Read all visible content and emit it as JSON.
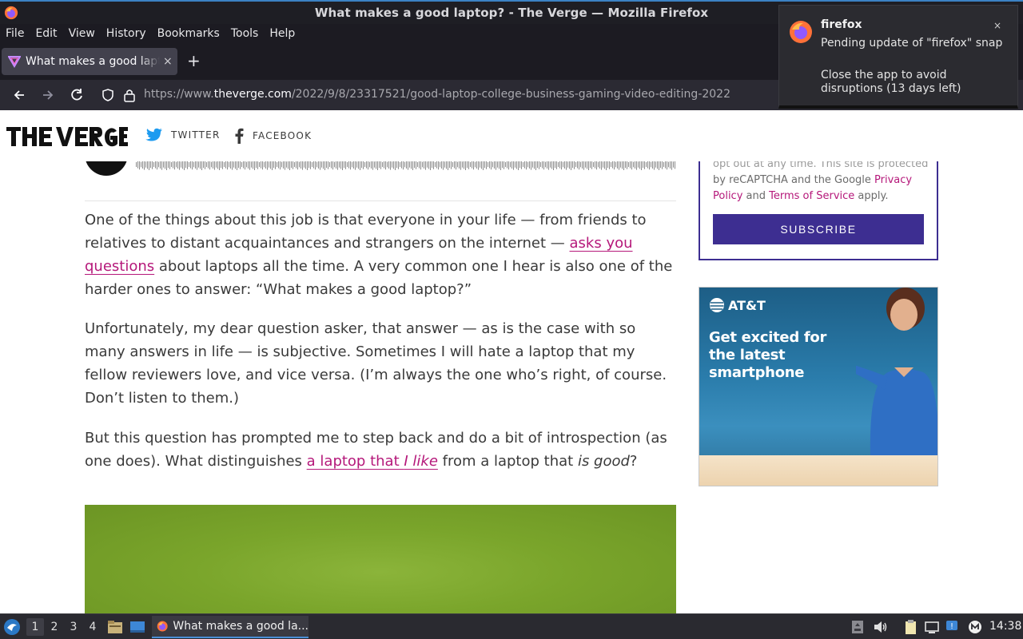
{
  "window": {
    "title": "What makes a good laptop? - The Verge — Mozilla Firefox"
  },
  "menu": {
    "items": [
      {
        "label": "File"
      },
      {
        "label": "Edit"
      },
      {
        "label": "View"
      },
      {
        "label": "History"
      },
      {
        "label": "Bookmarks"
      },
      {
        "label": "Tools"
      },
      {
        "label": "Help"
      }
    ]
  },
  "tab": {
    "title": "What makes a good laptop? - The Verge",
    "close": "×",
    "new_tab": "+"
  },
  "urlbar": {
    "prefix": "https://www.",
    "domain": "theverge.com",
    "path": "/2022/9/8/23317521/good-laptop-college-business-gaming-video-editing-2022"
  },
  "site": {
    "twitter_label": "TWITTER",
    "facebook_label": "FACEBOOK"
  },
  "article": {
    "p1_a": "One of the things about this job is that everyone in your life — from friends to relatives to distant acquaintances and strangers on the internet — ",
    "p1_link": "asks you questions",
    "p1_b": " about laptops all the time. A very common one I hear is also one of the harder ones to answer: “What makes a good laptop?”",
    "p2": "Unfortunately, my dear question asker, that answer — as is the case with so many answers in life — is subjective. Sometimes I will hate a laptop that my fellow reviewers love, and vice versa. (I’m always the one who’s right, of course. Don’t listen to them.)",
    "p3_a": "But this question has prompted me to step back and do a bit of introspection (as one does). What distinguishes ",
    "p3_link_a": "a laptop that ",
    "p3_link_em": "I like",
    "p3_b": " from a laptop that ",
    "p3_em": "is good",
    "p3_c": "?"
  },
  "newsletter": {
    "legal_cut": "opt out at any time. This site is protected",
    "legal_a": "by reCAPTCHA and the Google ",
    "privacy": "Privacy Policy",
    "legal_and": " and ",
    "terms": "Terms of Service",
    "legal_end": " apply.",
    "subscribe": "SUBSCRIBE"
  },
  "ad": {
    "brand": "AT&T",
    "headline": "Get excited for the latest smartphone"
  },
  "notification": {
    "app": "firefox",
    "line1": "Pending update of \"firefox\" snap",
    "line2": "Close the app to avoid disruptions (13 days left)",
    "close": "×"
  },
  "taskbar": {
    "workspaces": [
      "1",
      "2",
      "3",
      "4"
    ],
    "active_window": "What makes a good la...",
    "clock": "14:38"
  },
  "colors": {
    "accent_link": "#b5187a",
    "subscribe_bg": "#3d2e91",
    "firefox_chrome": "#1c1b22"
  }
}
